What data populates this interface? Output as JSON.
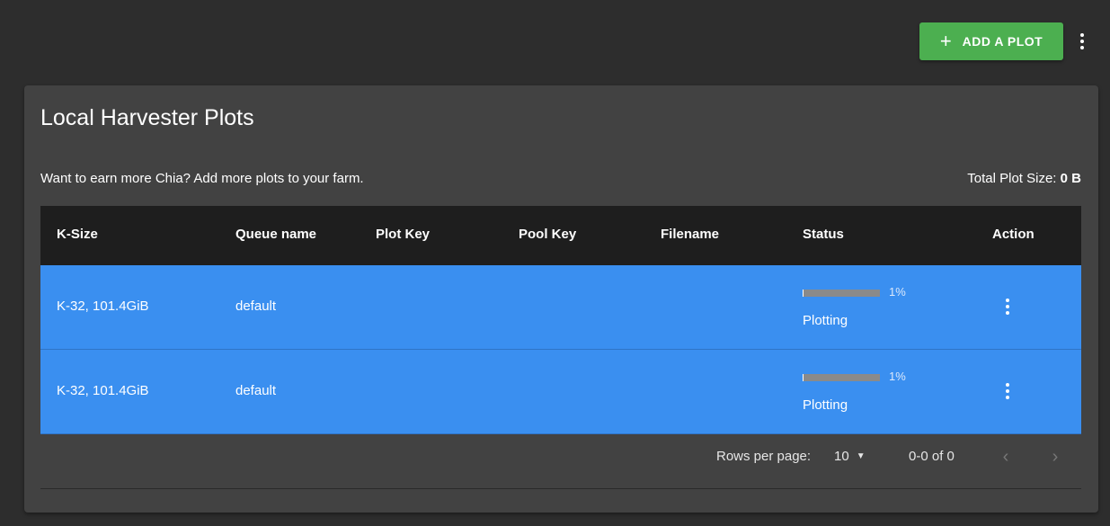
{
  "toolbar": {
    "add_plot_label": "ADD A PLOT",
    "add_icon": "plus-icon",
    "menu_icon": "more-vert-icon"
  },
  "card": {
    "title": "Local Harvester Plots",
    "subtitle": "Want to earn more Chia? Add more plots to your farm.",
    "total_label": "Total Plot Size:",
    "total_value": "0 B"
  },
  "table": {
    "columns": [
      "K-Size",
      "Queue name",
      "Plot Key",
      "Pool Key",
      "Filename",
      "Status",
      "Action"
    ],
    "rows": [
      {
        "ksize": "K-32, 101.4GiB",
        "queue": "default",
        "plot_key": "",
        "pool_key": "",
        "filename": "",
        "progress": 1,
        "progress_label": "1%",
        "status": "Plotting"
      },
      {
        "ksize": "K-32, 101.4GiB",
        "queue": "default",
        "plot_key": "",
        "pool_key": "",
        "filename": "",
        "progress": 1,
        "progress_label": "1%",
        "status": "Plotting"
      }
    ]
  },
  "pagination": {
    "rows_per_page_label": "Rows per page:",
    "rows_per_page_value": "10",
    "range": "0-0 of 0"
  },
  "colors": {
    "page_bg": "#2d2d2d",
    "card_bg": "#424242",
    "header_bg": "#1e1e1e",
    "row_bg": "#3a8ff0",
    "accent_green": "#4caf50"
  }
}
